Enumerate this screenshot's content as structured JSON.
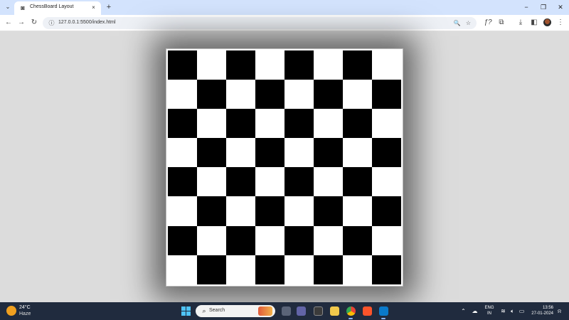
{
  "browser": {
    "tab": {
      "title": "ChessBoard Layout",
      "favicon": "page-icon",
      "close": "×"
    },
    "new_tab": "+",
    "window": {
      "minimize": "−",
      "maximize": "❐",
      "close": "✕"
    },
    "nav": {
      "back": "←",
      "forward": "→",
      "reload": "↻"
    },
    "address": {
      "url": "127.0.0.1:5500/index.html",
      "info_icon": "ⓘ"
    },
    "toolbar_icons": {
      "zoom": "🔍",
      "bookmark": "☆",
      "formula": "ƒ?",
      "extensions": "⧉",
      "download": "⤓",
      "sidepanel": "◧",
      "menu": "⋮"
    }
  },
  "chessboard": {
    "rows": 8,
    "cols": 8,
    "first_square": "black",
    "colors": {
      "dark": "#000000",
      "light": "#ffffff"
    }
  },
  "taskbar": {
    "weather": {
      "temp": "24°C",
      "condition": "Haze"
    },
    "search": {
      "label": "Search"
    },
    "apps": [
      "task-view",
      "teams",
      "store",
      "file-explorer",
      "chrome",
      "brave",
      "vscode"
    ],
    "tray": {
      "lang_line1": "ENG",
      "lang_line2": "IN",
      "time": "13:56",
      "date": "27-01-2024"
    }
  },
  "colors": {
    "taskbar": "#202b3e",
    "tabstrip": "#d3e3fd",
    "page_bg": "#dcdcdc"
  }
}
